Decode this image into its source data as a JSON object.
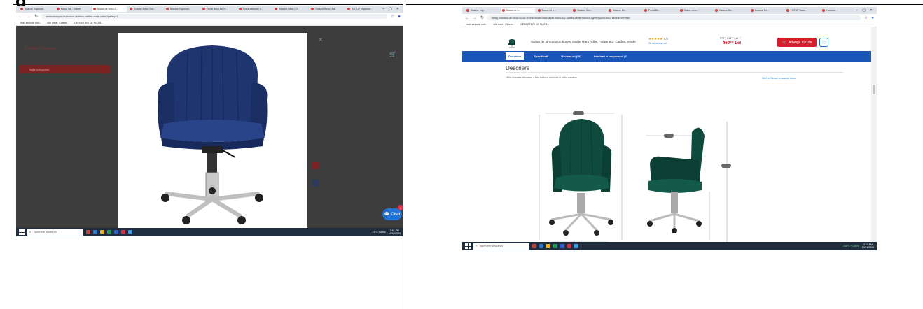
{
  "heading": {
    "left_text": "g",
    "right_text": "(p"
  },
  "left_screen": {
    "tabs": [
      "Scaune Ergonom...",
      "MIMA Ins - Cătere",
      "Scaun de Birou C...",
      "Scaune Birou Clor...",
      "Scaune Ergonom...",
      "Pantă Birou Lui H...",
      "Scaun relaxare n...",
      "Scaune Birou | G...",
      "Scaune Birou Ora...",
      "TOTUP Ergonom..."
    ],
    "url": "centrumrezparvi.ro/scaun-de-birou-catifea-verde.ohtml?gallery=1",
    "bookmarks": [
      "mail sesiune cutil...",
      "site area · Cătere...",
      "CERCETĂRI DE PIAȚĂ..."
    ],
    "page_logo": "Centrum Scaune",
    "category_button": "Toate categoriile",
    "chat": {
      "label": "Chat",
      "badge": "1"
    },
    "taskbar": {
      "search_placeholder": "Type here to search",
      "weather": "19°C Sunny",
      "time": "2:51 PM",
      "date": "10/11/2024"
    }
  },
  "right_screen": {
    "tabs": [
      "Scaune Erg...",
      "Scaun de b...",
      "Scaun de b...",
      "Scaune Biro...",
      "Scaune Bir...",
      "Pantă Bir...",
      "Scaun relax...",
      "Scaune Bir...",
      "Scaune Bir...",
      "TOTUP Scan...",
      "Instalare..."
    ],
    "url": "emag.ro/scaun-de-birou-cu-un-burete-moale-mark-adler-future-5-2-catifea-verde-future5-2green/pd/DDRUXYMBM/?ref=fam",
    "bookmarks": [
      "mail sesiune cutil...",
      "site area · Cătere...",
      "CERCETĂRI DE PIAȚĂ..."
    ],
    "product_title": "Scaun de birou cu un burete moale Mark Adler, Future 5.2, Catifea, Verde",
    "rating_stars": "★★★★★",
    "rating_value": "4.5",
    "reviews_link": "28 de review-uri",
    "prp_label": "PRP: 513⁹⁹ Lei ⓘ",
    "price": "469⁹⁹ Lei",
    "add_to_cart": "Adauga in Cos",
    "tabs_nav": [
      "Descriere",
      "Specificatii",
      "Review-uri (28)",
      "Intrebari si raspunsuri (2)"
    ],
    "section_title": "Descriere",
    "note": "Nota: Aceasta descriere a fost tradusa automat in limba romana.",
    "see_all": "Vezi si: Birouri si scaune birou",
    "taskbar": {
      "search_placeholder": "Type here to search",
      "weather": "AAPL +0.88%",
      "time": "4:24 PM",
      "date": "10/11/2024"
    }
  },
  "colors": {
    "chair_left": "#1f3570",
    "chair_right": "#0f4a3d",
    "tab_bar": "#1a56b8",
    "add_to_cart": "#d81e2c",
    "price": "#d0021b"
  }
}
